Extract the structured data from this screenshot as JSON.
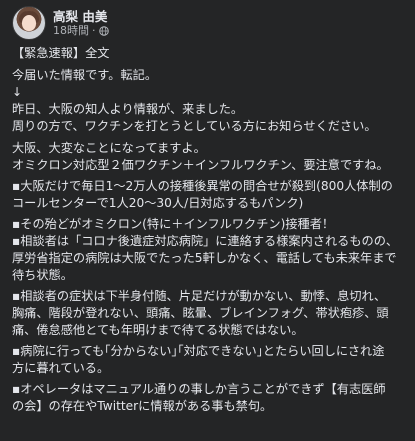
{
  "post": {
    "author_name": "高梨 由美",
    "timestamp": "18時間",
    "separator": "·",
    "icons": {
      "avatar": "profile-photo",
      "privacy": "globe-icon"
    },
    "lines": [
      "【緊急速報】全文",
      "今届いた情報です。転記。",
      "↓",
      "昨日、大阪の知人より情報が、来ました。",
      "周りの方で、ワクチンを打とうとしている方にお知らせください。",
      "大阪、大変なことになってますよ。",
      "オミクロン対応型２価ワクチン＋インフルワクチン、要注意ですね。",
      "▪大阪だけで毎日1〜2万人の接種後異常の問合せが殺到(800人体制の",
      "コールセンターで1人20〜30人/日対応するもパンク)",
      "▪その殆どがオミクロン(特に＋インフルワクチン)接種者！",
      "▪相談者は「コロナ後遺症対応病院」に連絡する様案内されるものの、",
      "厚労省指定の病院は大阪でたった5軒しかなく、電話しても未来年まで",
      "待ち状態。",
      "▪相談者の症状は下半身付随、片足だけが動かない、動悸、息切れ、",
      "胸痛、階段が登れない、頭痛、眩暈、ブレインフォグ、帯状疱疹、頭",
      "痛、倦怠感他とても年明けまで待てる状態ではない。",
      "▪病院に行っても｢分からない｣｢対応できない｣とたらい回しにされ途",
      "方に暮れている。",
      "▪オペレータはマニュアル通りの事しか言うことができず【有志医師",
      "の会】の存在やTwitterに情報がある事も禁句。"
    ]
  }
}
